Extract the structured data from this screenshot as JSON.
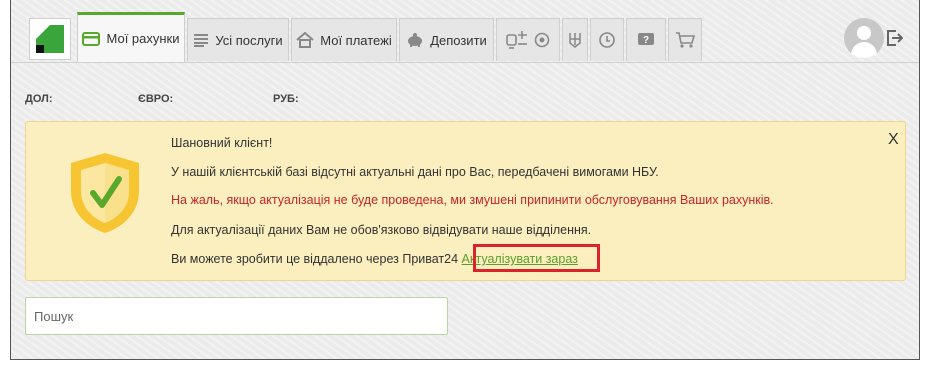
{
  "tabs": {
    "accounts": "Мої рахунки",
    "services": "Усі послуги",
    "payments": "Мої платежі",
    "deposits": "Депозити"
  },
  "currencies": {
    "usd": "ДОЛ:",
    "eur": "ЄВРО:",
    "rub": "РУБ:"
  },
  "alert": {
    "greeting": "Шановний клієнт!",
    "line1": "У нашій клієнтській базі відсутні актуальні дані про Вас, передбачені вимогами НБУ.",
    "line2_warning": "На жаль, якщо актуалізація не буде проведена, ми змушені припинити обслуговування Ваших рахунків.",
    "line3": "Для актуалізації даних Вам не обов'язково відвідувати наше відділення.",
    "line4_prefix": "Ви можете зробити це віддалено через Приват24",
    "action_link": "Актуалізувати зараз",
    "close_label": "X"
  },
  "search": {
    "placeholder": "Пошук",
    "value": ""
  },
  "icons": {
    "accounts": "card-icon",
    "services": "list-icon",
    "payments": "house-icon",
    "deposits": "piggy-bank-icon",
    "transport": "train-plane-icon",
    "sport": "ball-icon",
    "gov": "trident-icon",
    "history": "history-icon",
    "help": "help-icon",
    "shop": "cart-icon",
    "logout": "logout-icon"
  },
  "colors": {
    "brand_green": "#5aa82b",
    "alert_bg": "#fbefbf",
    "warning_red": "#c8242b",
    "highlight_red": "#d9242b",
    "shield_yellow": "#f6c531"
  }
}
